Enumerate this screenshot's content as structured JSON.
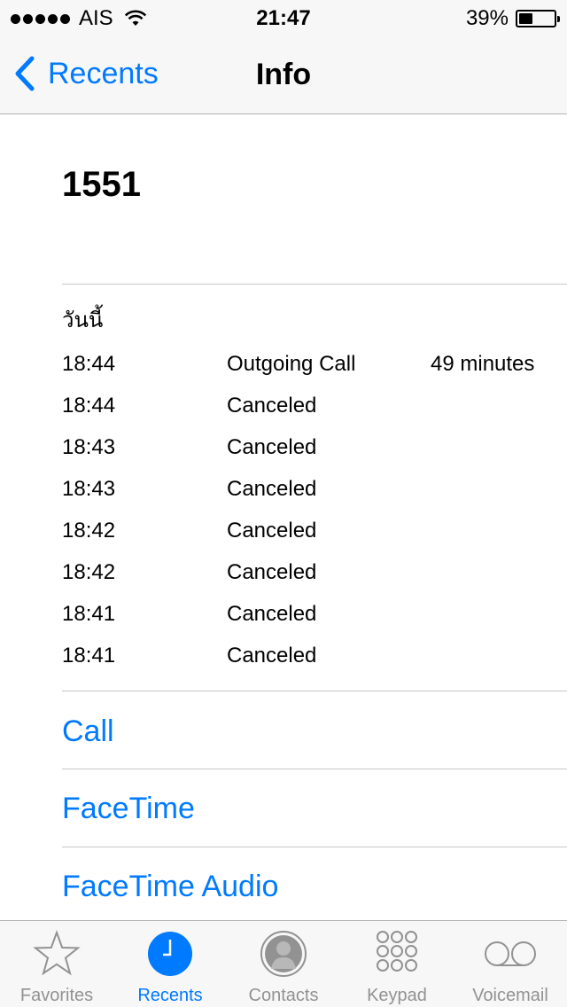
{
  "status_bar": {
    "carrier": "AIS",
    "time": "21:47",
    "battery_percent": "39%",
    "battery_level": 0.39
  },
  "nav": {
    "back_label": "Recents",
    "title": "Info"
  },
  "contact": {
    "number": "1551"
  },
  "history": {
    "date_label": "วันนี้",
    "rows": [
      {
        "time": "18:44",
        "type": "Outgoing Call",
        "duration": "49 minutes"
      },
      {
        "time": "18:44",
        "type": "Canceled",
        "duration": ""
      },
      {
        "time": "18:43",
        "type": "Canceled",
        "duration": ""
      },
      {
        "time": "18:43",
        "type": "Canceled",
        "duration": ""
      },
      {
        "time": "18:42",
        "type": "Canceled",
        "duration": ""
      },
      {
        "time": "18:42",
        "type": "Canceled",
        "duration": ""
      },
      {
        "time": "18:41",
        "type": "Canceled",
        "duration": ""
      },
      {
        "time": "18:41",
        "type": "Canceled",
        "duration": ""
      }
    ]
  },
  "actions": {
    "call": "Call",
    "facetime": "FaceTime",
    "facetime_audio": "FaceTime Audio"
  },
  "tab_bar": {
    "tabs": [
      {
        "label": "Favorites",
        "icon": "star-icon",
        "active": false
      },
      {
        "label": "Recents",
        "icon": "clock-icon",
        "active": true
      },
      {
        "label": "Contacts",
        "icon": "person-icon",
        "active": false
      },
      {
        "label": "Keypad",
        "icon": "keypad-icon",
        "active": false
      },
      {
        "label": "Voicemail",
        "icon": "voicemail-icon",
        "active": false
      }
    ]
  },
  "colors": {
    "accent": "#007aff",
    "inactive": "#929292",
    "bar_background": "#f7f7f7"
  }
}
